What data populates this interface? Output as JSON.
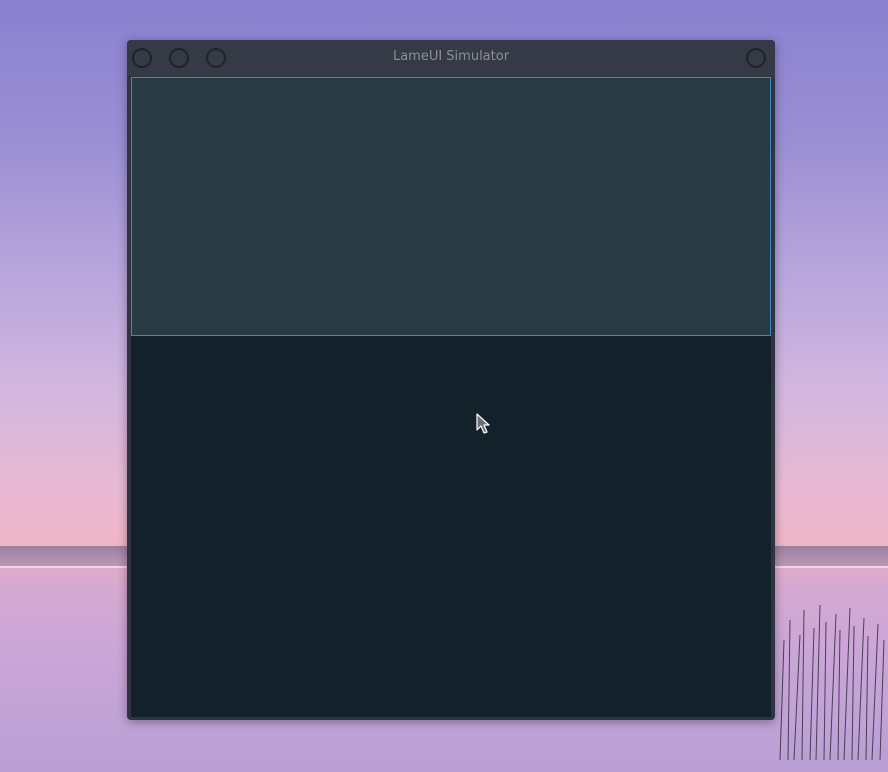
{
  "window": {
    "title": "LameUI Simulator"
  },
  "icons": {
    "cursor": "arrow-cursor-icon",
    "close": "circle-button-icon",
    "minimize": "circle-button-icon",
    "maximize": "circle-button-icon",
    "menu": "circle-button-icon"
  },
  "colors": {
    "titlebar": "#353a46",
    "content_background": "#13222a",
    "highlight_fill": "#283a44",
    "highlight_border": "#3c88c4",
    "title_text": "#8b8f99"
  }
}
